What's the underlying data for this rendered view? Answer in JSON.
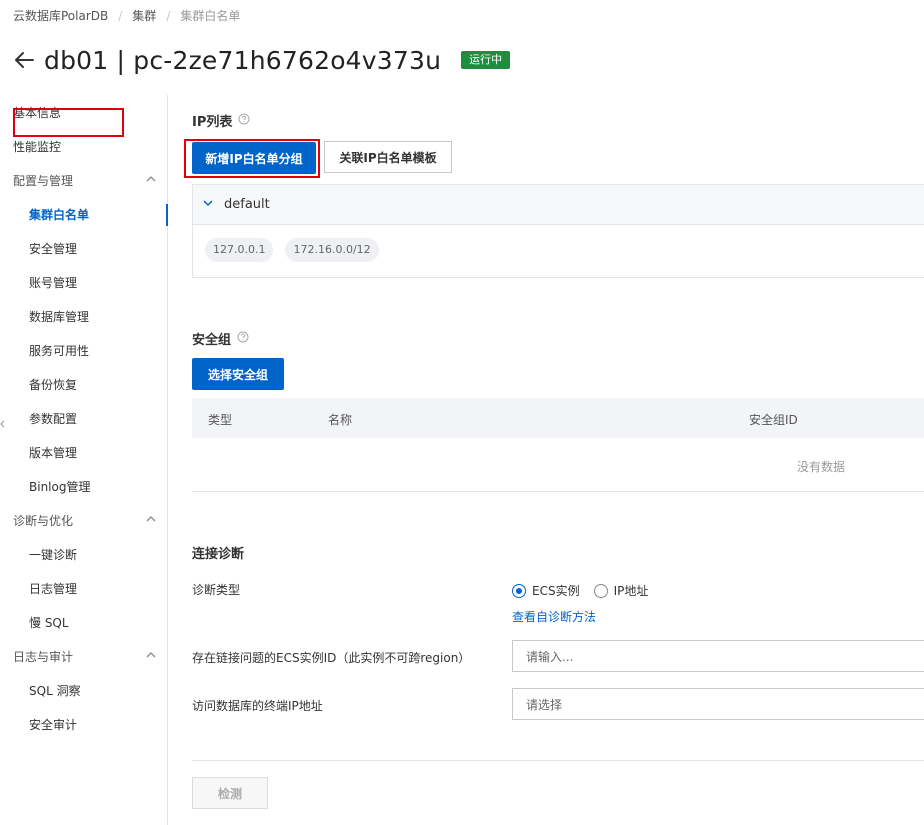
{
  "breadcrumb": [
    "云数据库PolarDB",
    "集群",
    "集群白名单"
  ],
  "header": {
    "title": "db01 | pc-2ze71h6762o4v373u",
    "status": "运行中"
  },
  "sidebar": {
    "items": [
      {
        "label": "基本信息",
        "kind": "top",
        "active": false
      },
      {
        "label": "性能监控",
        "kind": "top",
        "active": false
      },
      {
        "label": "配置与管理",
        "kind": "group",
        "active": false
      },
      {
        "label": "集群白名单",
        "kind": "sub",
        "active": true
      },
      {
        "label": "安全管理",
        "kind": "sub",
        "active": false
      },
      {
        "label": "账号管理",
        "kind": "sub",
        "active": false
      },
      {
        "label": "数据库管理",
        "kind": "sub",
        "active": false
      },
      {
        "label": "服务可用性",
        "kind": "sub",
        "active": false
      },
      {
        "label": "备份恢复",
        "kind": "sub",
        "active": false
      },
      {
        "label": "参数配置",
        "kind": "sub",
        "active": false
      },
      {
        "label": "版本管理",
        "kind": "sub",
        "active": false
      },
      {
        "label": "Binlog管理",
        "kind": "sub",
        "active": false
      },
      {
        "label": "诊断与优化",
        "kind": "group",
        "active": false
      },
      {
        "label": "一键诊断",
        "kind": "sub",
        "active": false
      },
      {
        "label": "日志管理",
        "kind": "sub",
        "active": false
      },
      {
        "label": "慢 SQL",
        "kind": "sub",
        "active": false
      },
      {
        "label": "日志与审计",
        "kind": "group",
        "active": false
      },
      {
        "label": "SQL 洞察",
        "kind": "sub",
        "active": false
      },
      {
        "label": "安全审计",
        "kind": "sub",
        "active": false
      }
    ]
  },
  "ip_list": {
    "title": "IP列表",
    "add_button": "新增IP白名单分组",
    "template_button": "关联IP白名单模板",
    "group": {
      "name": "default",
      "ips": [
        "127.0.0.1",
        "172.16.0.0/12"
      ]
    }
  },
  "security_group": {
    "title": "安全组",
    "select_button": "选择安全组",
    "columns": [
      "类型",
      "名称",
      "安全组ID"
    ],
    "empty_text": "没有数据"
  },
  "diagnosis": {
    "title": "连接诊断",
    "type_label": "诊断类型",
    "options": [
      "ECS实例",
      "IP地址"
    ],
    "selected_option": "ECS实例",
    "help_link": "查看自诊断方法",
    "ecs_label": "存在链接问题的ECS实例ID（此实例不可跨region）",
    "ecs_placeholder": "请输入...",
    "ip_label": "访问数据库的终端IP地址",
    "ip_placeholder": "请选择",
    "check_button": "检测"
  },
  "colors": {
    "primary": "#0064c8",
    "status_green": "#1e8e3e",
    "highlight_red": "#e0000b"
  }
}
